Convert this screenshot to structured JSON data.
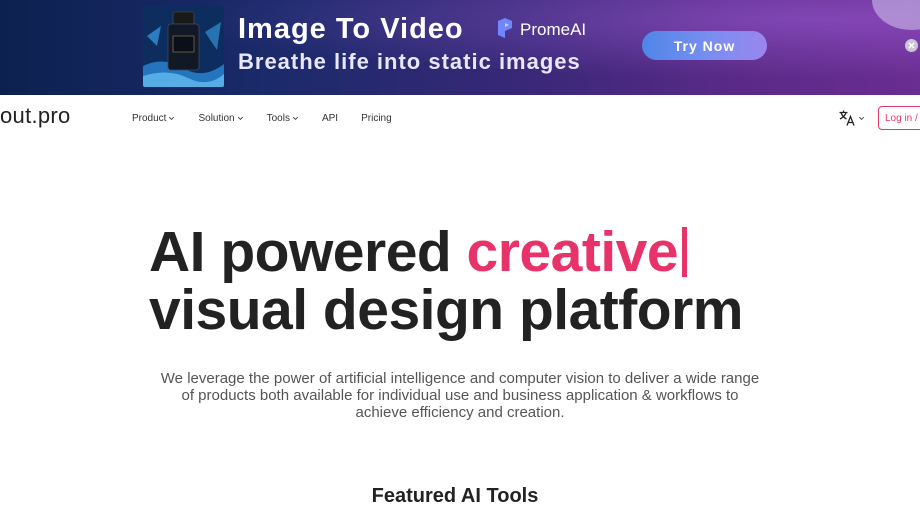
{
  "ad": {
    "title": "Image To Video",
    "subtitle": "Breathe life into static images",
    "brand": "PromeAI",
    "cta": "Try Now"
  },
  "nav": {
    "logo": "out.pro",
    "items": [
      {
        "label": "Product",
        "has_dropdown": true
      },
      {
        "label": "Solution",
        "has_dropdown": true
      },
      {
        "label": "Tools",
        "has_dropdown": true
      },
      {
        "label": "API",
        "has_dropdown": false
      },
      {
        "label": "Pricing",
        "has_dropdown": false
      }
    ],
    "login": "Log in /"
  },
  "hero": {
    "line1_prefix": "AI powered ",
    "line1_accent": "creative",
    "line2": "visual design platform",
    "description": "We leverage the power of artificial intelligence and computer vision to deliver a wide range of products both available for individual use and business application & workflows to achieve efficiency and creation."
  },
  "featured": {
    "title": "Featured AI Tools"
  },
  "colors": {
    "accent": "#e8326a",
    "text": "#222222",
    "ad_cta_start": "#4f86e8",
    "ad_cta_end": "#9a86ee"
  },
  "icons": [
    "promeai-logo-icon",
    "chevron-down-icon",
    "translate-icon",
    "close-icon"
  ]
}
